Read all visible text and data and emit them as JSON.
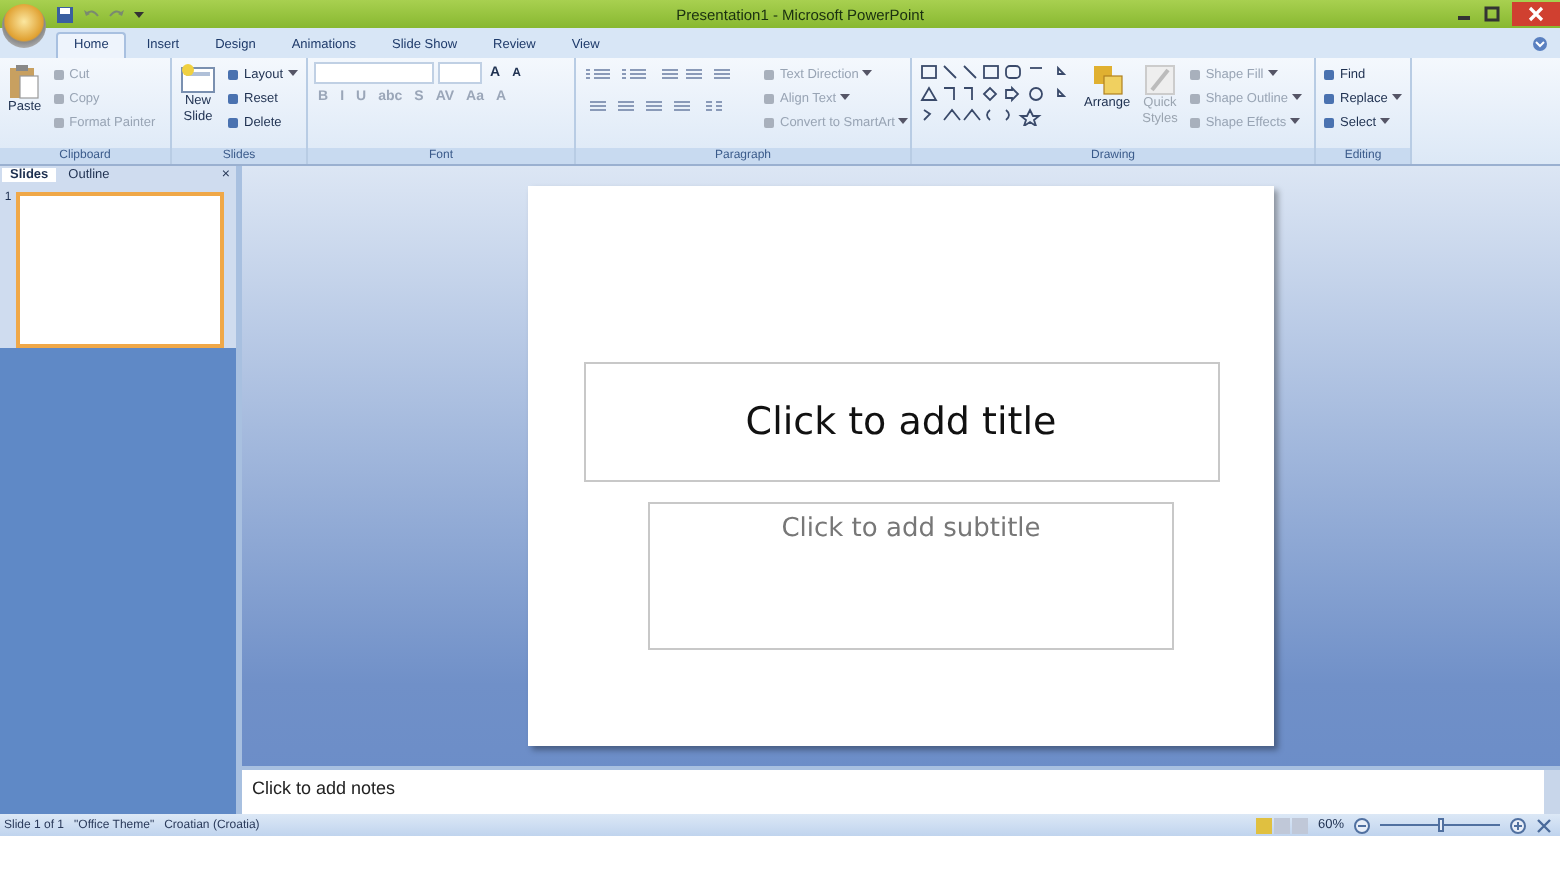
{
  "window": {
    "title": "Presentation1 - Microsoft PowerPoint"
  },
  "tabs": [
    {
      "label": "Home",
      "selected": true
    },
    {
      "label": "Insert",
      "selected": false
    },
    {
      "label": "Design",
      "selected": false
    },
    {
      "label": "Animations",
      "selected": false
    },
    {
      "label": "Slide Show",
      "selected": false
    },
    {
      "label": "Review",
      "selected": false
    },
    {
      "label": "View",
      "selected": false
    }
  ],
  "clipboard": {
    "label": "Clipboard",
    "paste": "Paste",
    "items": [
      {
        "label": "Cut",
        "disabled": true,
        "dropdown": false
      },
      {
        "label": "Copy",
        "disabled": true,
        "dropdown": false
      },
      {
        "label": "Format Painter",
        "disabled": true,
        "dropdown": false
      }
    ]
  },
  "slides_group": {
    "label": "Slides",
    "new_slide": [
      "New",
      "Slide"
    ],
    "items": [
      {
        "label": "Layout",
        "disabled": false,
        "dropdown": true
      },
      {
        "label": "Reset",
        "disabled": false,
        "dropdown": false
      },
      {
        "label": "Delete",
        "disabled": false,
        "dropdown": false
      }
    ]
  },
  "font": {
    "label": "Font",
    "size_buttons": [
      "A",
      "A"
    ],
    "buttons": [
      "B",
      "I",
      "U",
      "abc",
      "S",
      "AV",
      "Aa",
      "A"
    ]
  },
  "paragraph": {
    "label": "Paragraph",
    "items": [
      {
        "label": "Text Direction",
        "disabled": true,
        "dropdown": true
      },
      {
        "label": "Align Text",
        "disabled": true,
        "dropdown": true
      },
      {
        "label": "Convert to SmartArt",
        "disabled": true,
        "dropdown": true
      }
    ]
  },
  "drawing": {
    "label": "Drawing",
    "arrange": "Arrange",
    "quick_styles": [
      "Quick",
      "Styles"
    ],
    "items": [
      {
        "label": "Shape Fill",
        "disabled": true,
        "dropdown": true
      },
      {
        "label": "Shape Outline",
        "disabled": true,
        "dropdown": true
      },
      {
        "label": "Shape Effects",
        "disabled": true,
        "dropdown": true
      }
    ]
  },
  "editing": {
    "label": "Editing",
    "items": [
      {
        "label": "Find",
        "disabled": false,
        "dropdown": false
      },
      {
        "label": "Replace",
        "disabled": false,
        "dropdown": true
      },
      {
        "label": "Select",
        "disabled": false,
        "dropdown": true
      }
    ]
  },
  "panel": {
    "tabs": [
      {
        "label": "Slides",
        "selected": true
      },
      {
        "label": "Outline",
        "selected": false
      }
    ],
    "close": "×",
    "thumbnails": [
      {
        "number": "1",
        "selected": true
      }
    ]
  },
  "slide": {
    "title": "Click to add title",
    "subtitle": "Click to add subtitle"
  },
  "notes": {
    "placeholder": "Click to add notes"
  },
  "status_bar": {
    "items": [
      "Slide 1 of 1",
      "\"Office Theme\"",
      "Croatian (Croatia)"
    ],
    "zoom": "60%",
    "zoom_slider": {
      "level": 0.5
    }
  }
}
